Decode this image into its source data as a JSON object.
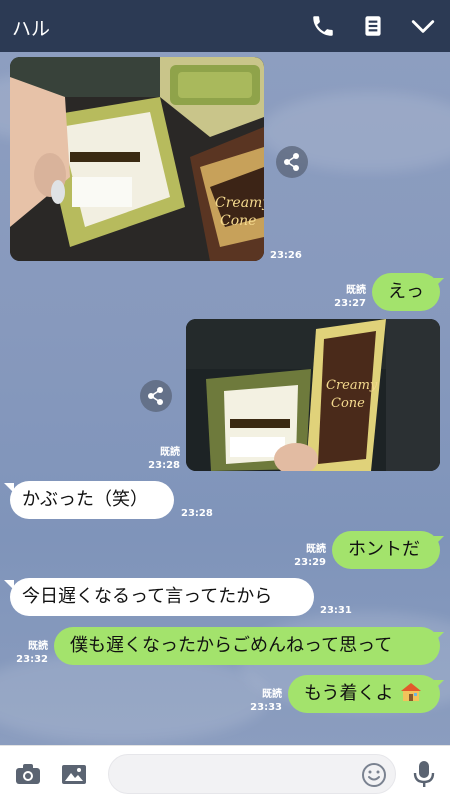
{
  "header": {
    "title": "ハル",
    "bg": "#2c3a54",
    "icons": [
      "phone-icon",
      "notes-icon",
      "chevron-down-icon"
    ]
  },
  "messages": {
    "photo1": {
      "time": "23:26"
    },
    "m1": {
      "text": "えっ",
      "read": "既読",
      "time": "23:27"
    },
    "photo2": {
      "read": "既読",
      "time": "23:28"
    },
    "m2": {
      "text": "かぶった（笑）",
      "time": "23:28"
    },
    "m3": {
      "text": "ホントだ",
      "read": "既読",
      "time": "23:29"
    },
    "m4": {
      "text": "今日遅くなるって言ってたから",
      "time": "23:31"
    },
    "m5": {
      "text": "僕も遅くなったからごめんねって思って",
      "read": "既読",
      "time": "23:32"
    },
    "m6": {
      "text": "もう着くよ",
      "read": "既読",
      "time": "23:33"
    }
  },
  "input": {
    "icons": [
      "camera-icon",
      "image-icon",
      "emoji-icon",
      "microphone-icon"
    ]
  },
  "colors": {
    "bubble_out": "#a3e36c",
    "bubble_in": "#ffffff"
  }
}
